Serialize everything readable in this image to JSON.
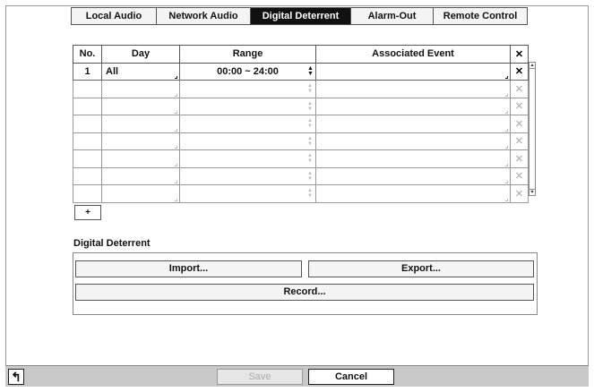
{
  "tabs": [
    {
      "label": "Local Audio",
      "active": false
    },
    {
      "label": "Network Audio",
      "active": false
    },
    {
      "label": "Digital Deterrent",
      "active": true
    },
    {
      "label": "Alarm-Out",
      "active": false
    },
    {
      "label": "Remote Control",
      "active": false
    }
  ],
  "table": {
    "headers": {
      "no": "No.",
      "day": "Day",
      "range": "Range",
      "event": "Associated Event",
      "delete_icon": "close-icon"
    },
    "first_row": {
      "no": "1",
      "day": "All",
      "range": "00:00 ~ 24:00",
      "event": ""
    },
    "empty_rows": 7
  },
  "add_button": "+",
  "digital_deterrent": {
    "label": "Digital Deterrent",
    "import": "Import...",
    "export": "Export...",
    "record": "Record..."
  },
  "footer": {
    "back_icon": "undo-arrow-icon",
    "save": "Save",
    "cancel": "Cancel"
  },
  "colors": {
    "active_tab_bg": "#111111",
    "footer_bg": "#c8c8c8",
    "disabled_text": "#aaaaaa"
  }
}
